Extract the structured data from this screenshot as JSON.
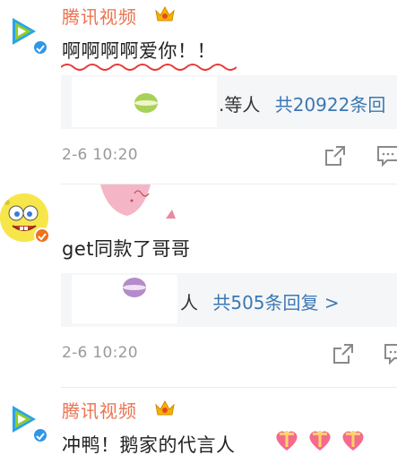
{
  "comments": [
    {
      "author": "腾讯视频",
      "text": "啊啊啊啊爱你！！",
      "reply_preview": {
        "suffix": ".等人",
        "count_link": "共20922条回"
      },
      "time": "2-6 10:20",
      "verified": true,
      "crown": true
    },
    {
      "author": "",
      "text": "get同款了哥哥",
      "reply_preview": {
        "suffix": "人",
        "count_link": "共505条回复 >"
      },
      "time": "2-6 10:20",
      "verified": true,
      "crown": false
    },
    {
      "author": "腾讯视频",
      "text": "冲鸭！鹅家的代言人",
      "time": "",
      "verified": true,
      "crown": true
    }
  ],
  "icons": {
    "share": "share-icon",
    "comment": "comment-icon",
    "heart": "heart-gift-icon",
    "crown": "crown-icon",
    "verified": "verified-badge-icon"
  },
  "colors": {
    "author": "#eb7350",
    "link": "#3b78b3",
    "time": "#9a9a9a",
    "reply_bg": "#f5f6f8"
  }
}
